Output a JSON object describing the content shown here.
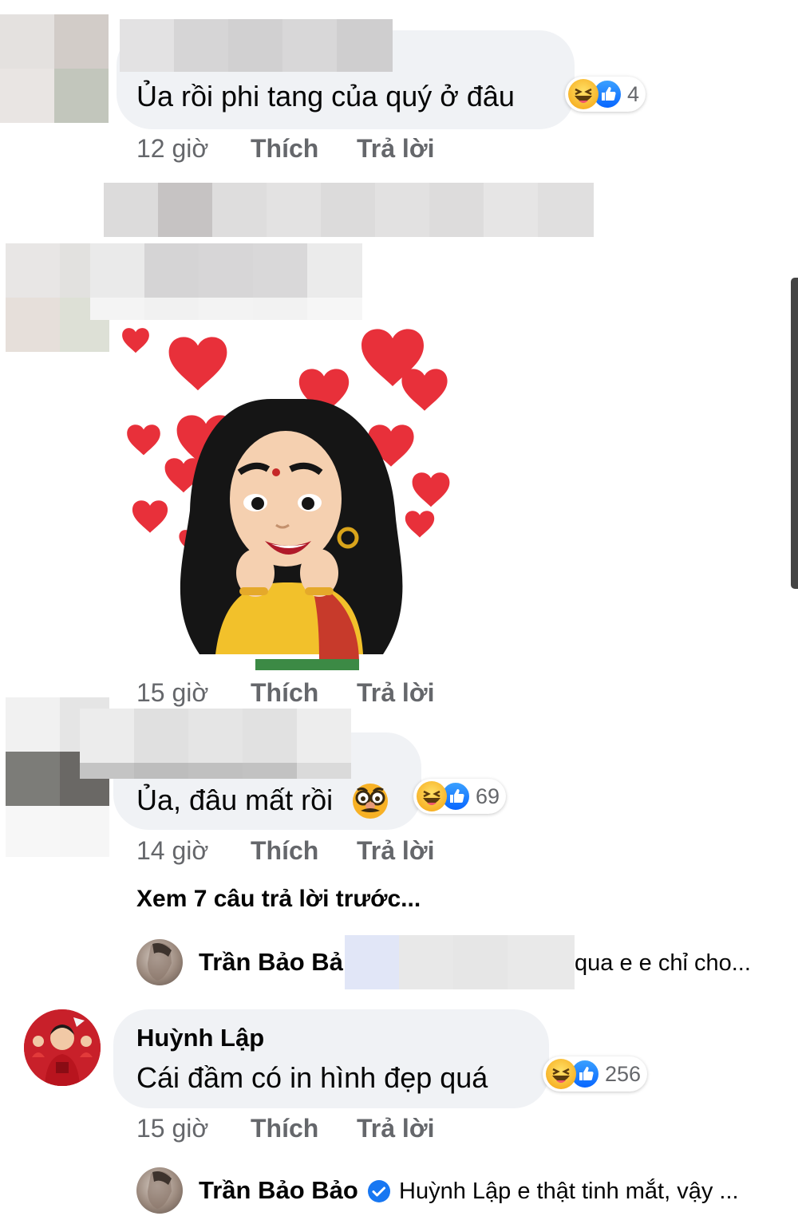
{
  "comments": [
    {
      "text": "Ủa rồi phi tang của quý ở đâu",
      "time": "12 giờ",
      "like_label": "Thích",
      "reply_label": "Trả lời",
      "reaction_count": "4"
    },
    {
      "time": "15 giờ",
      "like_label": "Thích",
      "reply_label": "Trả lời",
      "sticker": "heart-eyes-avatar-sticker"
    },
    {
      "text": "Ủa, đâu mất rồi",
      "emoji": "disguise-face-icon",
      "time": "14 giờ",
      "like_label": "Thích",
      "reply_label": "Trả lời",
      "reaction_count": "69"
    },
    {
      "name": "Huỳnh Lập",
      "text": "Cái đầm có in hình đẹp quá",
      "time": "15 giờ",
      "like_label": "Thích",
      "reply_label": "Trả lời",
      "reaction_count": "256"
    }
  ],
  "view_previous": "Xem 7 câu trả lời trước...",
  "reply_previews": [
    {
      "name": "Trần Bảo Bả",
      "text": "qua e e chỉ cho..."
    },
    {
      "name": "Trần Bảo Bảo",
      "verified": true,
      "text": "Huỳnh Lập e thật tinh mắt, vậy ..."
    }
  ],
  "colors": {
    "bubble": "#f0f2f5",
    "meta_text": "#65676b",
    "like_blue": "#0866ff",
    "haha_yellow": "#f7b125",
    "verified_blue": "#1877f2"
  }
}
